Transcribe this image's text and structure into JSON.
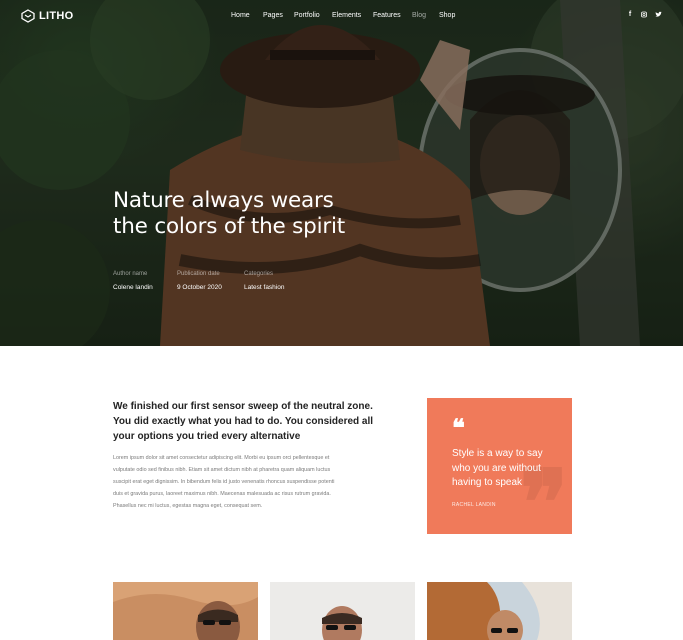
{
  "brand": {
    "logo_text": "LITHO",
    "accent": "#f07a5a"
  },
  "nav": {
    "items": [
      {
        "label": "Home",
        "active": false
      },
      {
        "label": "Pages",
        "active": false
      },
      {
        "label": "Portfolio",
        "active": false
      },
      {
        "label": "Elements",
        "active": false
      },
      {
        "label": "Features",
        "active": false
      },
      {
        "label": "Blog",
        "active": true
      },
      {
        "label": "Shop",
        "active": false
      }
    ],
    "social": [
      {
        "icon": "facebook-icon",
        "glyph": "f"
      },
      {
        "icon": "instagram-icon",
        "glyph": "◎"
      },
      {
        "icon": "twitter-icon",
        "glyph": "🐦"
      }
    ]
  },
  "hero": {
    "title_line1": "Nature always wears",
    "title_line2": "the colors of the spirit",
    "meta": [
      {
        "label": "Author name",
        "value": "Colene landin"
      },
      {
        "label": "Publication date",
        "value": "9 October 2020"
      },
      {
        "label": "Categories",
        "value": "Latest fashion"
      }
    ]
  },
  "article": {
    "lead": "We finished our first sensor sweep of the neutral zone. You did exactly what you had to do. You considered all your options you tried every alternative",
    "body_lines": [
      "Lorem ipsum dolor sit amet consectetur adipiscing elit. Morbi eu ipsum orci pellentesque et",
      "vulputate odio sed finibus nibh. Etiam sit amet dictum nibh at pharetra quam aliquam luctus",
      "suscipit erat eget dignissim. In bibendum felis id justo venenatis rhoncus suspendisse potenti",
      "duis et gravida purus, laoreet maximus nibh. Maecenas malesuada ac risus rutrum gravida.",
      "Phasellus nec mi luctus, egestas magna eget, consequat sem."
    ]
  },
  "quote": {
    "mark": "❝",
    "text": "Style is a way to say who you are without having to speak",
    "author": "RACHEL LANDIN"
  }
}
